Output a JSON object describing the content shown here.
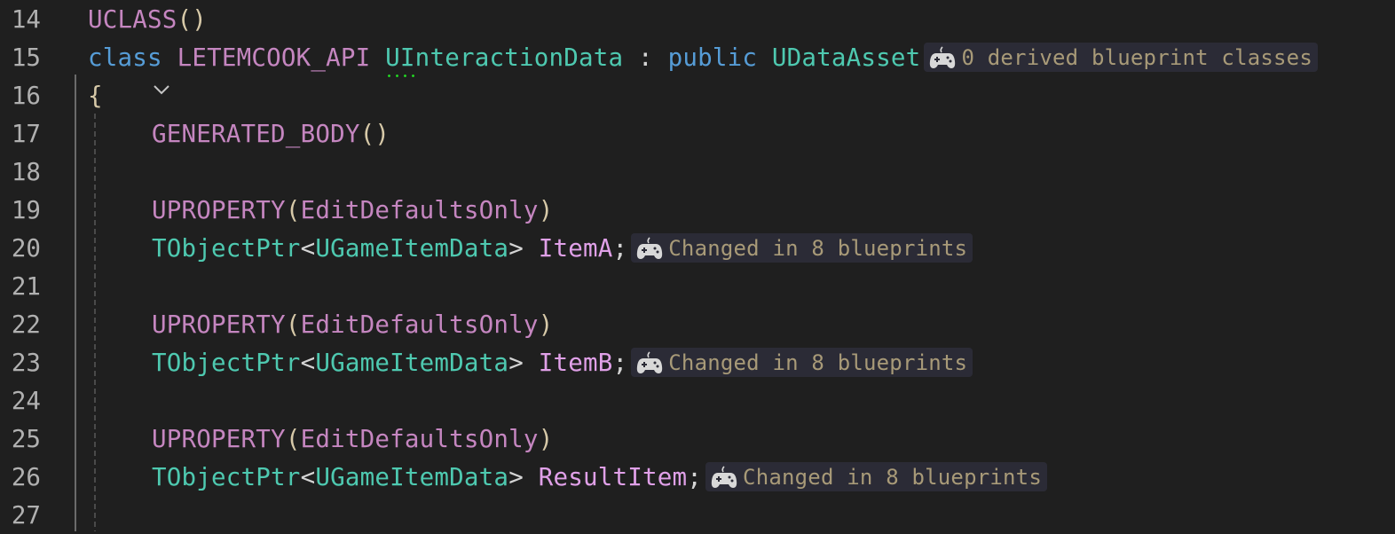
{
  "editor": {
    "lines": [
      {
        "number": "14"
      },
      {
        "number": "15"
      },
      {
        "number": "16"
      },
      {
        "number": "17"
      },
      {
        "number": "18"
      },
      {
        "number": "19"
      },
      {
        "number": "20"
      },
      {
        "number": "21"
      },
      {
        "number": "22"
      },
      {
        "number": "23"
      },
      {
        "number": "24"
      },
      {
        "number": "25"
      },
      {
        "number": "26"
      },
      {
        "number": "27"
      }
    ],
    "tokens": {
      "uclass": "UCLASS",
      "parens": "()",
      "class_kw": "class",
      "api_macro": "LETEMCOOK_API",
      "class_name": "UInteractionData",
      "colon": " : ",
      "public_kw": "public",
      "base_class": "UDataAsset",
      "open_brace": "{",
      "generated_body": "GENERATED_BODY",
      "uproperty": "UPROPERTY",
      "open_paren": "(",
      "close_paren": ")",
      "specifier": "EditDefaultsOnly",
      "tobjectptr": "TObjectPtr",
      "lt": "<",
      "gt": "> ",
      "item_type": "UGameItemData",
      "semicolon": ";",
      "member_a": "ItemA",
      "member_b": "ItemB",
      "member_result": "ResultItem"
    },
    "hints": {
      "class_hint": "0 derived blueprint classes",
      "item_a_hint": "Changed in 8 blueprints",
      "item_b_hint": "Changed in 8 blueprints",
      "result_item_hint": "Changed in 8 blueprints",
      "icon": "gamepad-icon"
    },
    "colors": {
      "background": "#1f1f1f",
      "keyword": "#569cd6",
      "macro": "#c586c0",
      "type": "#4ec9b0",
      "member": "#e0a0e8",
      "hint_text": "#a89a78",
      "hint_background": "#2b2b36"
    }
  }
}
